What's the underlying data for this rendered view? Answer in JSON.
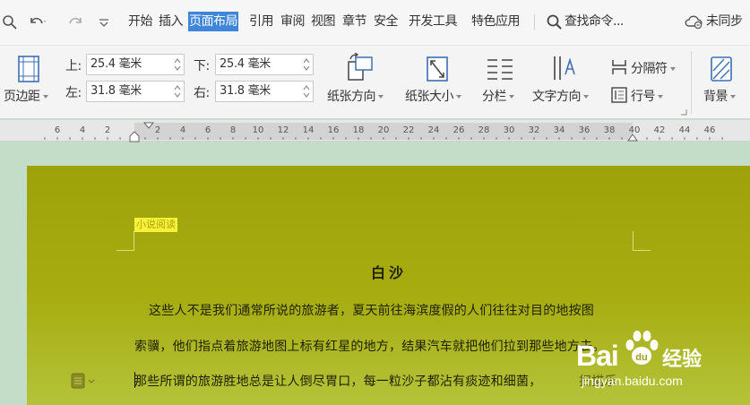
{
  "menubar": {
    "tabs": [
      "开始",
      "插入",
      "页面布局",
      "引用",
      "审阅",
      "视图",
      "章节",
      "安全",
      "开发工具",
      "特色应用"
    ],
    "active_tab": "页面布局",
    "search_label": "查找命令...",
    "sync_label": "未同步"
  },
  "ribbon": {
    "margins_label": "页边距",
    "top_label": "上:",
    "top_value": "25.4 毫米",
    "bottom_label": "下:",
    "bottom_value": "25.4 毫米",
    "left_label": "左:",
    "left_value": "31.8 毫米",
    "right_label": "右:",
    "right_value": "31.8 毫米",
    "orientation_label": "纸张方向",
    "size_label": "纸张大小",
    "columns_label": "分栏",
    "text_direction_label": "文字方向",
    "separator_label": "分隔符",
    "line_number_label": "行号",
    "background_label": "背景"
  },
  "ruler": {
    "ticks": [
      "6",
      "4",
      "2",
      "2",
      "4",
      "6",
      "8",
      "10",
      "12",
      "14",
      "16",
      "18",
      "20",
      "22",
      "24",
      "26",
      "28",
      "30",
      "32",
      "34",
      "36",
      "38",
      "40",
      "42",
      "44",
      "46"
    ]
  },
  "document": {
    "header_tag": "小说阅读",
    "title": "白沙",
    "para1": "这些人不是我们通常所说的旅游者，夏天前往海滨度假的人们往往对目的地按图",
    "para2": "索骥，他们指点着旅游地图上标有红星的地方，结果汽车就把他们拉到那些地方去。",
    "para3": "那些所谓的旅游胜地总是让人倒尽胃口，每一粒沙子都沾有痰迹和细菌，",
    "para3_tail": "扫描乐"
  },
  "watermark": {
    "brand": "Bai",
    "brand_tail": "经验",
    "url": "jingyan.baidu.com"
  },
  "colors": {
    "accent": "#3f86d8",
    "page_bg": "#a3a80e",
    "highlight": "#f6f23a",
    "canvas_bg": "#c3ddc9"
  }
}
